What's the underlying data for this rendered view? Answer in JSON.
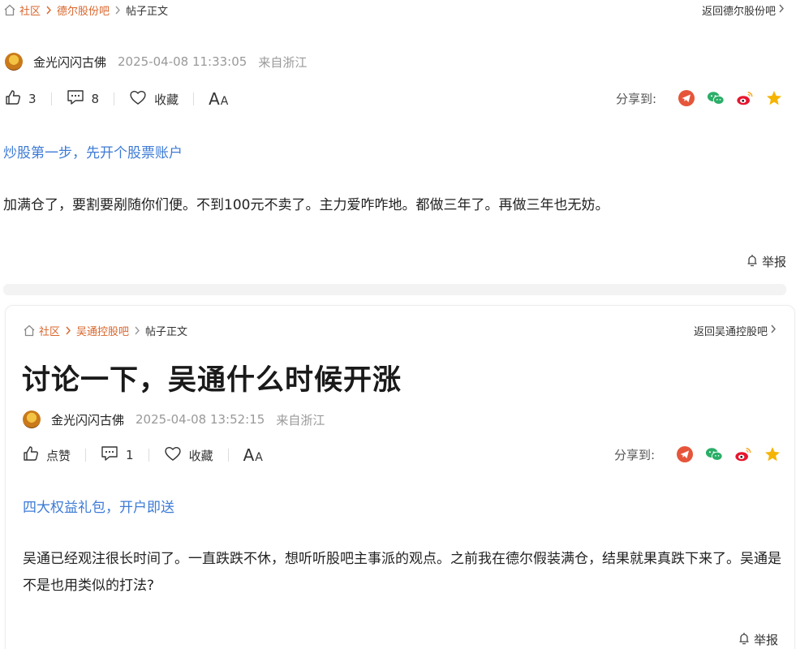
{
  "post1": {
    "breadcrumb": {
      "community": "社区",
      "forum": "德尔股份吧",
      "current": "帖子正文"
    },
    "back_link": "返回德尔股份吧",
    "author": "金光闪闪古佛",
    "time": "2025-04-08 11:33:05",
    "location": "来自浙江",
    "like_count": "3",
    "comment_count": "8",
    "favorite_label": "收藏",
    "font_label_big": "A",
    "font_label_small": "A",
    "share_label": "分享到:",
    "promo": "炒股第一步，先开个股票账户",
    "content": "加满仓了，要割要剐随你们便。不到100元不卖了。主力爱咋咋地。都做三年了。再做三年也无妨。",
    "report": "举报"
  },
  "post2": {
    "breadcrumb": {
      "community": "社区",
      "forum": "吴通控股吧",
      "current": "帖子正文"
    },
    "back_link": "返回吴通控股吧",
    "title": "讨论一下，吴通什么时候开涨",
    "author": "金光闪闪古佛",
    "time": "2025-04-08 13:52:15",
    "location": "来自浙江",
    "like_label": "点赞",
    "comment_count": "1",
    "favorite_label": "收藏",
    "font_label_big": "A",
    "font_label_small": "A",
    "share_label": "分享到:",
    "promo": "四大权益礼包，开户即送",
    "content": "吴通已经观注很长时间了。一直跌跌不休，想听听股吧主事派的观点。之前我在德尔假装满仓，结果就果真跌下来了。吴通是不是也用类似的打法?",
    "report": "举报"
  },
  "colors": {
    "accent": "#d9652b",
    "link_blue": "#3d7bd6",
    "muted": "#999999",
    "weibo_red": "#e6162d",
    "wechat_green": "#2aae67",
    "star_yellow": "#f5b400"
  },
  "icons": [
    "home-icon",
    "chevron-right-icon",
    "thumbs-up-icon",
    "comment-icon",
    "heart-icon",
    "share-telegram-icon",
    "wechat-icon",
    "weibo-icon",
    "star-icon",
    "report-bell-icon"
  ]
}
